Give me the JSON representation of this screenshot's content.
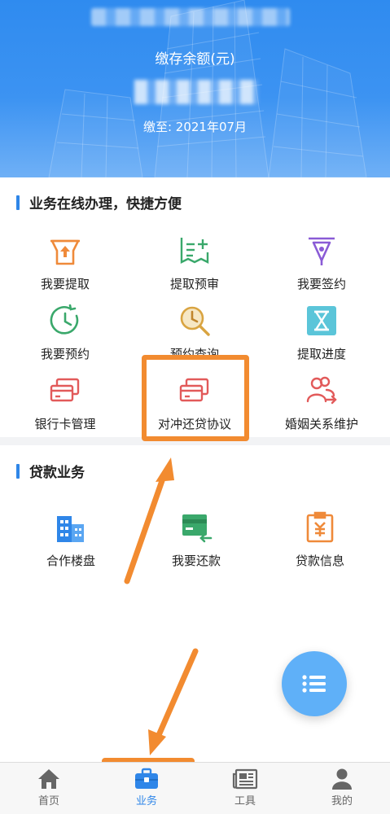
{
  "header": {
    "balance_label": "缴存余额(元)",
    "paid_until": "缴至: 2021年07月"
  },
  "section_online": {
    "title": "业务在线办理，快捷方便",
    "items": [
      {
        "label": "我要提取",
        "icon": "withdraw-tray-icon"
      },
      {
        "label": "提取预审",
        "icon": "checklist-icon"
      },
      {
        "label": "我要签约",
        "icon": "fountain-pen-icon"
      },
      {
        "label": "我要预约",
        "icon": "clock-icon"
      },
      {
        "label": "预约查询",
        "icon": "magnify-clock-icon"
      },
      {
        "label": "提取进度",
        "icon": "hourglass-icon"
      },
      {
        "label": "银行卡管理",
        "icon": "bank-card-icon"
      },
      {
        "label": "对冲还贷协议",
        "icon": "bank-card-icon"
      },
      {
        "label": "婚姻关系维护",
        "icon": "users-arrow-icon"
      }
    ]
  },
  "section_loan": {
    "title": "贷款业务",
    "items": [
      {
        "label": "合作楼盘",
        "icon": "building-icon"
      },
      {
        "label": "我要还款",
        "icon": "repay-card-icon"
      },
      {
        "label": "贷款信息",
        "icon": "yuan-document-icon"
      }
    ]
  },
  "tabbar": {
    "tabs": [
      {
        "label": "首页",
        "icon": "home-icon"
      },
      {
        "label": "业务",
        "icon": "briefcase-icon",
        "active": true
      },
      {
        "label": "工具",
        "icon": "newspaper-icon"
      },
      {
        "label": "我的",
        "icon": "person-icon"
      }
    ]
  },
  "colors": {
    "accent": "#2f86e8",
    "highlight": "#f28b30",
    "orange_icon": "#ef8a3a",
    "green_icon": "#3aa86b",
    "purple_icon": "#8a5bd6",
    "red_icon": "#e25a5a"
  }
}
